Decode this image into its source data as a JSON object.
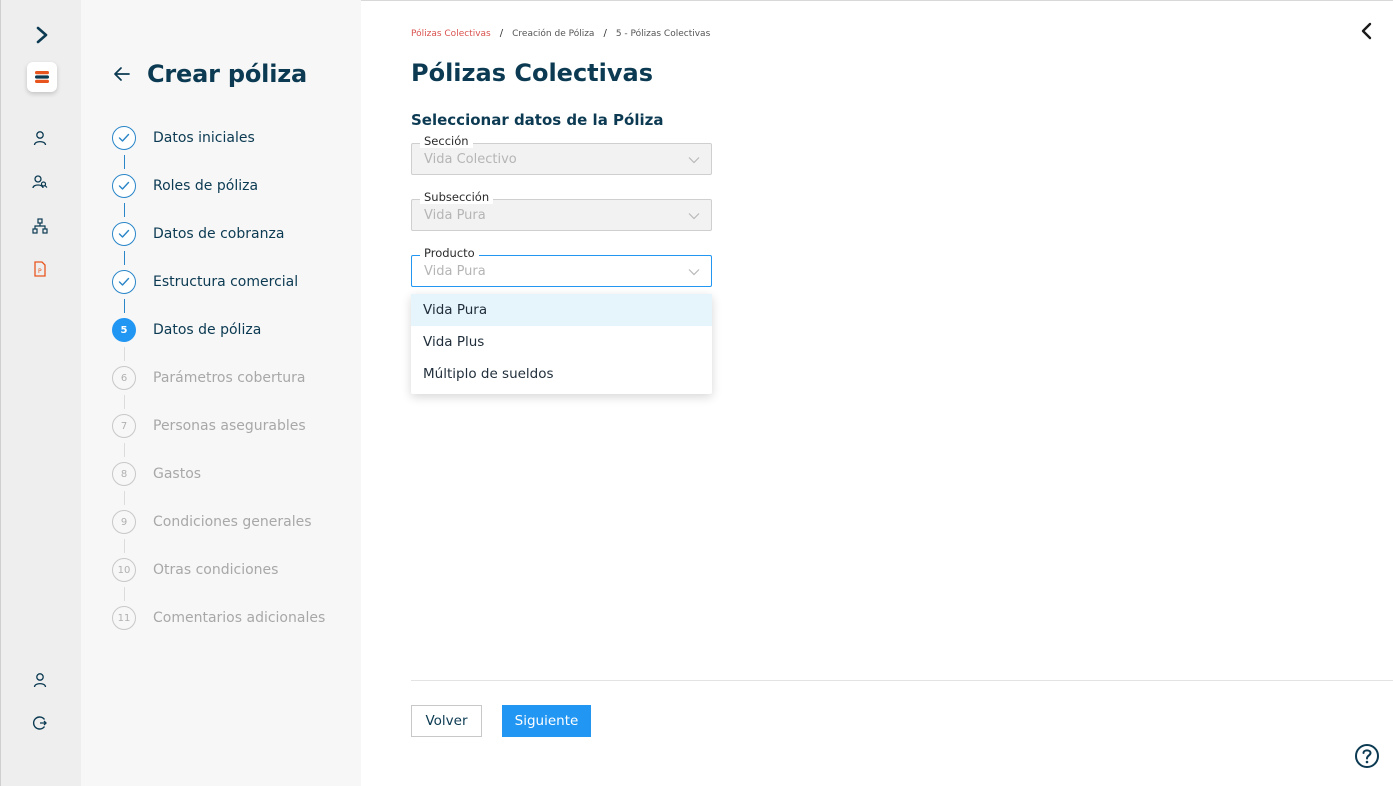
{
  "sidebar": {
    "title": "Crear póliza",
    "steps": [
      {
        "number": "1",
        "label": "Datos iniciales",
        "state": "done"
      },
      {
        "number": "2",
        "label": "Roles de póliza",
        "state": "done"
      },
      {
        "number": "3",
        "label": "Datos de cobranza",
        "state": "done"
      },
      {
        "number": "4",
        "label": "Estructura comercial",
        "state": "done"
      },
      {
        "number": "5",
        "label": "Datos de póliza",
        "state": "active"
      },
      {
        "number": "6",
        "label": "Parámetros cobertura",
        "state": "pending"
      },
      {
        "number": "7",
        "label": "Personas asegurables",
        "state": "pending"
      },
      {
        "number": "8",
        "label": "Gastos",
        "state": "pending"
      },
      {
        "number": "9",
        "label": "Condiciones generales",
        "state": "pending"
      },
      {
        "number": "10",
        "label": "Otras condiciones",
        "state": "pending"
      },
      {
        "number": "11",
        "label": "Comentarios adicionales",
        "state": "pending"
      }
    ]
  },
  "breadcrumb": [
    "Pólizas Colectivas",
    "Creación de Póliza",
    "5 - Pólizas Colectivas"
  ],
  "page": {
    "title": "Pólizas Colectivas",
    "section_title": "Seleccionar datos de la Póliza"
  },
  "form": {
    "seccion": {
      "label": "Sección",
      "value": "Vida Colectivo"
    },
    "subseccion": {
      "label": "Subsección",
      "value": "Vida Pura"
    },
    "producto": {
      "label": "Producto",
      "value": "Vida Pura"
    }
  },
  "dropdown": {
    "options": [
      "Vida Pura",
      "Vida Plus",
      "Múltiplo de sueldos"
    ],
    "selected": "Vida Pura"
  },
  "buttons": {
    "back": "Volver",
    "next": "Siguiente"
  },
  "colors": {
    "primary": "#2196f3",
    "title": "#0b3a52",
    "breadcrumb_active": "#d9534f",
    "brand_orange": "#e8541e"
  },
  "icons": {
    "rail": [
      "expand-icon",
      "logo-icon",
      "user-icon",
      "users-search-icon",
      "org-chart-icon",
      "document-icon",
      "profile-icon",
      "logout-icon"
    ],
    "misc": [
      "back-arrow-icon",
      "collapse-icon",
      "chevron-down-icon",
      "help-icon"
    ]
  }
}
